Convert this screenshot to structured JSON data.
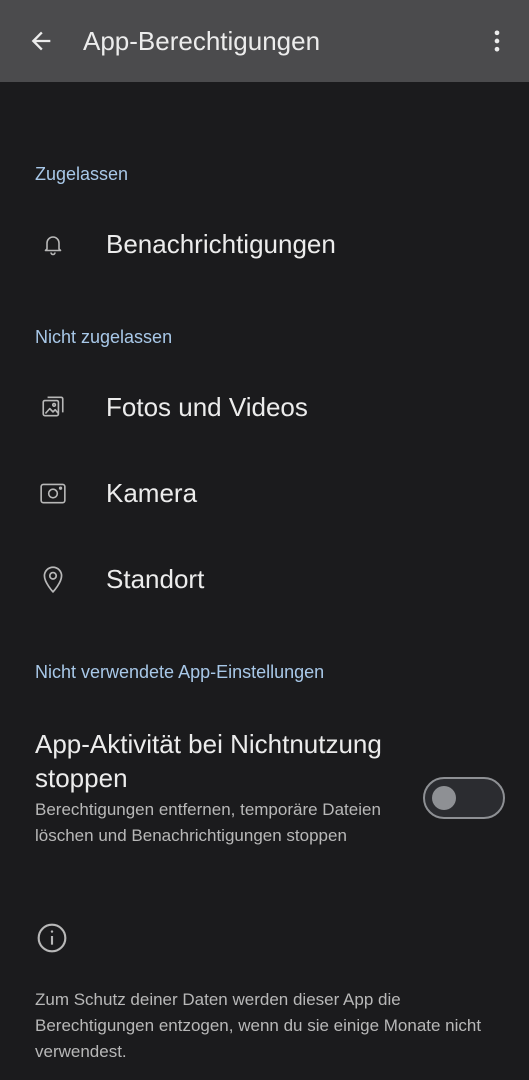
{
  "appbar": {
    "title": "App-Berechtigungen",
    "back_icon": "arrow-back-icon",
    "more_icon": "more-vert-icon"
  },
  "sections": {
    "allowed_header": "Zugelassen",
    "not_allowed_header": "Nicht zugelassen",
    "unused_header": "Nicht verwendete App-Einstellungen"
  },
  "permissions": {
    "allowed": [
      {
        "label": "Benachrichtigungen",
        "icon": "bell-icon"
      }
    ],
    "not_allowed": [
      {
        "label": "Fotos und Videos",
        "icon": "photos-icon"
      },
      {
        "label": "Kamera",
        "icon": "camera-icon"
      },
      {
        "label": "Standort",
        "icon": "location-pin-icon"
      }
    ]
  },
  "unused_setting": {
    "title": "App-Aktivität bei Nichtnutzung stoppen",
    "summary": "Berechtigungen entfernen, temporäre Dateien löschen und Benachrichtigungen stoppen",
    "toggle_on": false
  },
  "footer": {
    "icon": "info-icon",
    "text": "Zum Schutz deiner Daten werden dieser App die Berechtigungen entzogen, wenn du sie einige Monate nicht verwendest."
  },
  "colors": {
    "background": "#1b1b1d",
    "appbar": "#4b4b4d",
    "accent_header": "#a8c8e8",
    "primary_text": "#ececec",
    "secondary_text": "#b8b8b8"
  }
}
